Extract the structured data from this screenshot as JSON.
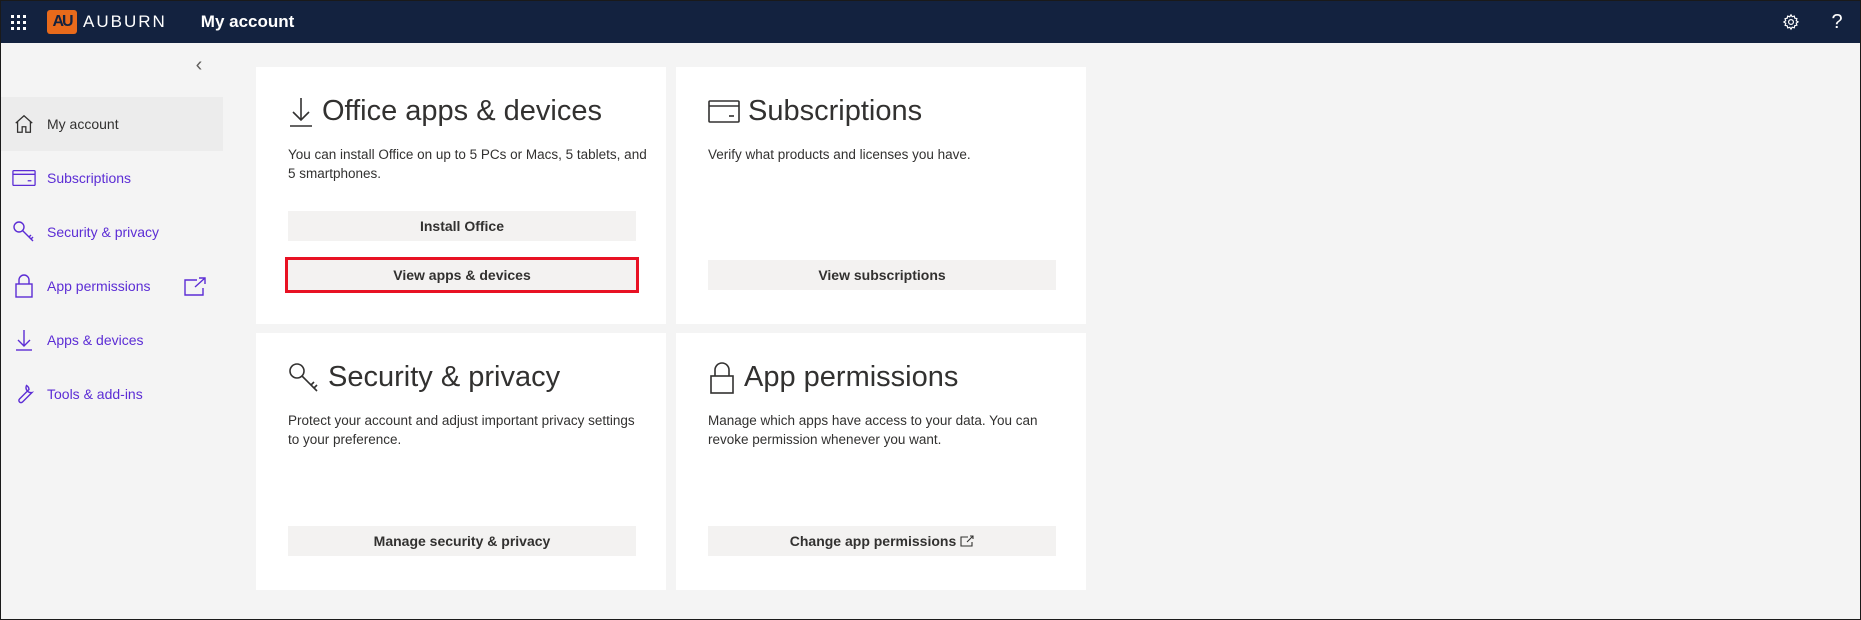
{
  "header": {
    "logo_text": "AUBURN",
    "logo_mark": "AU",
    "title": "My account",
    "icons": [
      "waffle-icon",
      "gear-icon",
      "help-icon"
    ],
    "help_glyph": "?"
  },
  "sidebar": {
    "collapse_glyph": "‹",
    "items": [
      {
        "label": "My account",
        "icon": "home-icon",
        "active": true
      },
      {
        "label": "Subscriptions",
        "icon": "card-icon"
      },
      {
        "label": "Security & privacy",
        "icon": "key-icon"
      },
      {
        "label": "App permissions",
        "icon": "lock-icon",
        "external": true
      },
      {
        "label": "Apps & devices",
        "icon": "download-icon"
      },
      {
        "label": "Tools & add-ins",
        "icon": "wrench-icon"
      }
    ]
  },
  "cards": {
    "office": {
      "title": "Office apps & devices",
      "description": "You can install Office on up to 5 PCs or Macs, 5 tablets, and 5 smartphones.",
      "buttons": [
        "Install Office",
        "View apps & devices"
      ]
    },
    "subscriptions": {
      "title": "Subscriptions",
      "description": "Verify what products and licenses you have.",
      "button": "View subscriptions"
    },
    "security": {
      "title": "Security & privacy",
      "description": "Protect your account and adjust important privacy settings to your preference.",
      "button": "Manage security & privacy"
    },
    "permissions": {
      "title": "App permissions",
      "description": "Manage which apps have access to your data. You can revoke permission whenever you want.",
      "button": "Change app permissions"
    }
  },
  "colors": {
    "topbar": "#13223f",
    "accent_orange": "#e86a1b",
    "link_purple": "#5c2dd5",
    "highlight_red": "#e81123"
  }
}
